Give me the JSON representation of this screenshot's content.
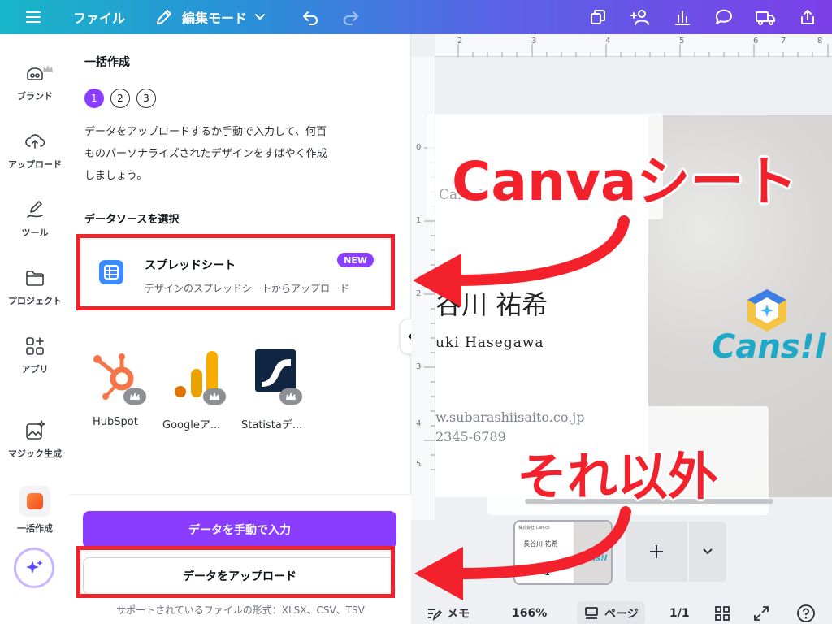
{
  "toolbar": {
    "file_label": "ファイル",
    "edit_mode_label": "編集モード"
  },
  "rail": {
    "items": [
      {
        "label": "ブランド"
      },
      {
        "label": "アップロード"
      },
      {
        "label": "ツール"
      },
      {
        "label": "プロジェクト"
      },
      {
        "label": "アプリ"
      },
      {
        "label": "マジック生成"
      },
      {
        "label": "一括作成"
      }
    ]
  },
  "panel": {
    "title": "一括作成",
    "steps": [
      "1",
      "2",
      "3"
    ],
    "active_step": 1,
    "description_line1": "データをアップロードするか手動で入力して、何百",
    "description_line2": "ものパーソナライズされたデザインをすばやく作成",
    "description_line3": "しましょう。",
    "section_title": "データソースを選択",
    "spreadsheet": {
      "name": "スプレッドシート",
      "badge": "NEW",
      "description": "デザインのスプレッドシートからアップロード"
    },
    "apps": [
      {
        "label": "HubSpot"
      },
      {
        "label": "Googleア..."
      },
      {
        "label": "Statistaデ..."
      }
    ],
    "manual_button": "データを手動で入力",
    "upload_button": "データをアップロード",
    "formats_note": "サポートされているファイルの形式：XLSX、CSV、TSV"
  },
  "canvas": {
    "ruler_top": [
      "2",
      "3",
      "4",
      "5",
      "6",
      "7",
      "8"
    ],
    "ruler_left": [
      "0",
      "1",
      "2",
      "3",
      "4",
      "5"
    ],
    "card": {
      "company": "Can-cil",
      "name_jp": "谷川 祐希",
      "name_en": "uki Hasegawa",
      "website": "w.subarashiisaito.co.jp",
      "phone": "2345-6789",
      "logo_text": "Cans!l"
    },
    "thumbnail": {
      "line1": "株式会社 Can-cil",
      "line2": "長谷川 祐希",
      "logo": "Cans!l",
      "page_number": "1"
    }
  },
  "statusbar": {
    "notes_label": "メモ",
    "zoom": "166%",
    "pages_label": "ページ",
    "page_count": "1/1"
  },
  "annotations": {
    "canva_sheet": "Canvaシート",
    "others": "それ以外"
  },
  "colors": {
    "accent_purple": "#8b3dff",
    "annotation_red": "#f3212c",
    "spreadsheet_blue": "#3b8dff"
  }
}
